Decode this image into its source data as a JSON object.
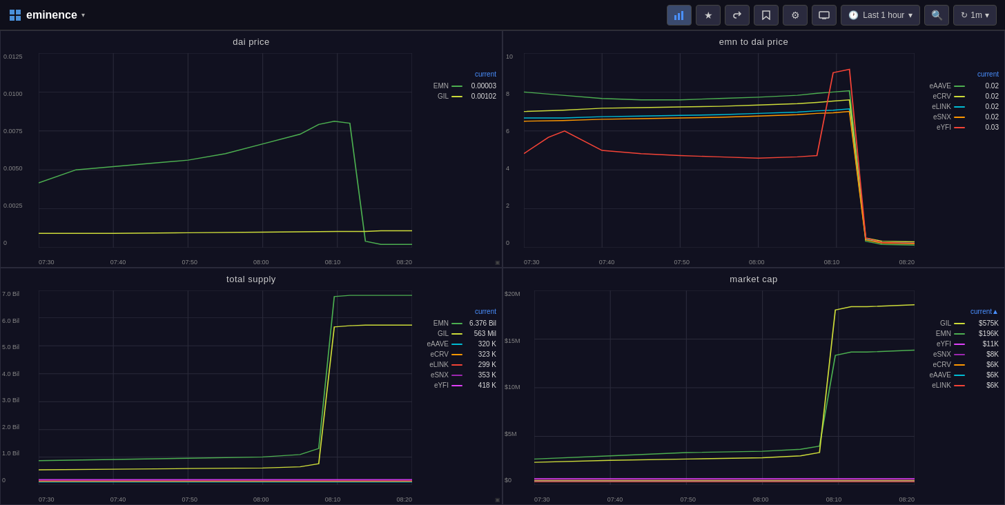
{
  "app": {
    "name": "eminence",
    "dropdown": "▾"
  },
  "header": {
    "time_label": "Last 1 hour",
    "refresh_label": "1m",
    "buttons": [
      "bar-chart",
      "star",
      "share",
      "bookmark",
      "settings",
      "display",
      "search",
      "refresh"
    ]
  },
  "charts": {
    "dai_price": {
      "title": "dai price",
      "legend_header": "current",
      "series": [
        {
          "name": "EMN",
          "color": "#4caf50",
          "value": "0.00003"
        },
        {
          "name": "GIL",
          "color": "#cddc39",
          "value": "0.00102"
        }
      ],
      "y_labels": [
        "0.0125",
        "0.0100",
        "0.0075",
        "0.0050",
        "0.0025",
        "0"
      ],
      "x_labels": [
        "07:30",
        "07:40",
        "07:50",
        "08:00",
        "08:10",
        "08:20"
      ]
    },
    "emn_to_dai": {
      "title": "emn to dai price",
      "legend_header": "current",
      "series": [
        {
          "name": "eAAVE",
          "color": "#4caf50",
          "value": "0.02"
        },
        {
          "name": "eCRV",
          "color": "#cddc39",
          "value": "0.02"
        },
        {
          "name": "eLINK",
          "color": "#00bcd4",
          "value": "0.02"
        },
        {
          "name": "eSNX",
          "color": "#ff9800",
          "value": "0.02"
        },
        {
          "name": "eYFI",
          "color": "#f44336",
          "value": "0.03"
        }
      ],
      "y_labels": [
        "10",
        "8",
        "6",
        "4",
        "2",
        "0"
      ],
      "x_labels": [
        "07:30",
        "07:40",
        "07:50",
        "08:00",
        "08:10",
        "08:20"
      ]
    },
    "total_supply": {
      "title": "total supply",
      "legend_header": "current",
      "series": [
        {
          "name": "EMN",
          "color": "#4caf50",
          "value": "6.376 Bil"
        },
        {
          "name": "GIL",
          "color": "#cddc39",
          "value": "563 Mil"
        },
        {
          "name": "eAAVE",
          "color": "#00bcd4",
          "value": "320 K"
        },
        {
          "name": "eCRV",
          "color": "#ff9800",
          "value": "323 K"
        },
        {
          "name": "eLINK",
          "color": "#f44336",
          "value": "299 K"
        },
        {
          "name": "eSNX",
          "color": "#9c27b0",
          "value": "353 K"
        },
        {
          "name": "eYFI",
          "color": "#e040fb",
          "value": "418 K"
        }
      ],
      "y_labels": [
        "7.0 Bil",
        "6.0 Bil",
        "5.0 Bil",
        "4.0 Bil",
        "3.0 Bil",
        "2.0 Bil",
        "1.0 Bil",
        "0"
      ],
      "x_labels": [
        "07:30",
        "07:40",
        "07:50",
        "08:00",
        "08:10",
        "08:20"
      ]
    },
    "market_cap": {
      "title": "market cap",
      "legend_header": "current▲",
      "series": [
        {
          "name": "GIL",
          "color": "#cddc39",
          "value": "$575K"
        },
        {
          "name": "EMN",
          "color": "#4caf50",
          "value": "$196K"
        },
        {
          "name": "eYFI",
          "color": "#e040fb",
          "value": "$11K"
        },
        {
          "name": "eSNX",
          "color": "#9c27b0",
          "value": "$8K"
        },
        {
          "name": "eCRV",
          "color": "#ff9800",
          "value": "$6K"
        },
        {
          "name": "eAAVE",
          "color": "#00bcd4",
          "value": "$6K"
        },
        {
          "name": "eLINK",
          "color": "#f44336",
          "value": "$6K"
        }
      ],
      "y_labels": [
        "$20M",
        "$15M",
        "$10M",
        "$5M",
        "$0"
      ],
      "x_labels": [
        "07:30",
        "07:40",
        "07:50",
        "08:00",
        "08:10",
        "08:20"
      ]
    }
  }
}
